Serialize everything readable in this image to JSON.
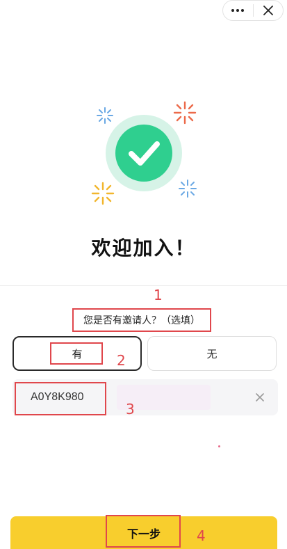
{
  "capsule": {
    "more_icon": "more-dots-icon",
    "close_icon": "close-icon"
  },
  "hero": {
    "icon": "check-circle-icon",
    "colors": {
      "ring": "#d6f3e7",
      "fill": "#2fcf8f",
      "spark_red": "#ec6a4a",
      "spark_blue": "#6aa8e4",
      "spark_yellow": "#f2b62d"
    }
  },
  "welcome_title": "欢迎加入！",
  "inviter": {
    "question": "您是否有邀请人？（选填）",
    "option_yes": "有",
    "option_no": "无",
    "selected": "有",
    "code_value": "A0Y8K980",
    "clear_icon": "clear-x-icon"
  },
  "annotations": [
    "1",
    "2",
    "3",
    "4"
  ],
  "next_button": {
    "label": "下一步",
    "color": "#f8ce2d"
  }
}
